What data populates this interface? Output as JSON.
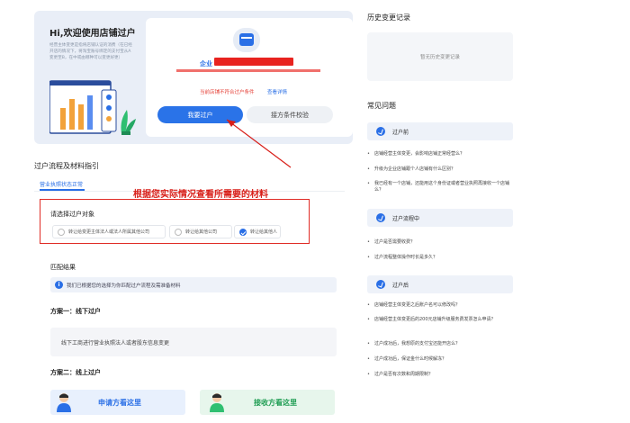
{
  "welcome": {
    "title": "Hi,欢迎使用店铺过户",
    "desc": "经营主体变更是指将店铺认证的消费（在已经开店的情况下，将淘宝账号绑定的支付宝从A变更至B，在中或由哪种可以变更好更）",
    "store_label": "企业",
    "warning": "当前店铺不符合过户条件",
    "warning_link": "查看详情",
    "primary_button": "我要过户",
    "secondary_button": "接方条件校验"
  },
  "process": {
    "section_title": "过户流程及材料指引",
    "tab_active": "营业执照状态正常",
    "annotation": "根据您实际情况查看所需要的材料",
    "select_label": "请选择过户对象",
    "options": [
      {
        "label": "转让给变更主体法人或法人所属其他公司",
        "checked": false
      },
      {
        "label": "转让给其他公司",
        "checked": false
      },
      {
        "label": "转让给其他人",
        "checked": true
      }
    ],
    "match_title": "匹配结果",
    "match_note": "我们已根据您的选择为你匹配过户流程及需准备材料",
    "plan1_title": "方案一：线下过户",
    "plan1_text": "线下工商进行营业执照法人或者股东信息变更",
    "plan2_title": "方案二：线上过户",
    "apply_button": "申请方看这里",
    "receive_button": "接收方看这里"
  },
  "history": {
    "title": "历史变更记录",
    "empty": "暂无历史变更记录"
  },
  "faq": {
    "title": "常见问题",
    "groups": [
      {
        "heading": "过户前",
        "items": [
          "店铺经营主体变更，会影响店铺正常经营么？",
          "升级为企业店铺跟个人店铺有什么区别？",
          "我已经有一个店铺，还能用这个身份证或者营业执照再接收一个店铺么？"
        ]
      },
      {
        "heading": "过户流程中",
        "items": [
          "过户是否需要收费？",
          "过户流程整体操作时长是多久？"
        ]
      },
      {
        "heading": "过户后",
        "items": [
          "店铺经营主体变更之后账户名可以修改吗？",
          "店铺经营主体变更后的200元店铺升级服务费发票怎么申请？",
          "过户成功后，我想原的支付宝还能开店么？",
          "过户成功后，保证金什么时候解冻？",
          "过户是否有次数和周期限制？"
        ]
      }
    ]
  },
  "colors": {
    "accent": "#2a6fe6",
    "annotation_red": "#d81e18",
    "success_green": "#1f9d53"
  }
}
